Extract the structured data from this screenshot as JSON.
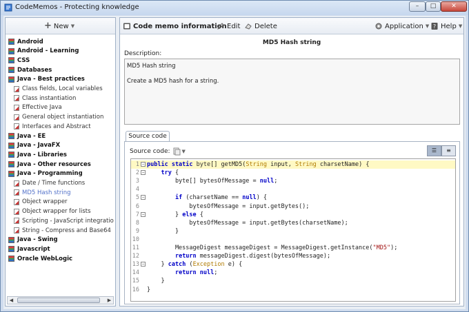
{
  "window": {
    "title": "CodeMemos - Protecting knowledge",
    "min": "–",
    "max": "□",
    "close": "✕"
  },
  "left": {
    "new_label": "New",
    "tree": [
      {
        "label": "Android",
        "type": "cat"
      },
      {
        "label": "Android - Learning",
        "type": "cat"
      },
      {
        "label": "CSS",
        "type": "cat"
      },
      {
        "label": "Databases",
        "type": "cat"
      },
      {
        "label": "Java - Best practices",
        "type": "cat"
      },
      {
        "label": "Class fields, Local variables",
        "type": "sub"
      },
      {
        "label": "Class instantiation",
        "type": "sub"
      },
      {
        "label": "Effective Java",
        "type": "sub"
      },
      {
        "label": "General object instantiation",
        "type": "sub"
      },
      {
        "label": "Interfaces and Abstract",
        "type": "sub"
      },
      {
        "label": "Java - EE",
        "type": "cat"
      },
      {
        "label": "Java - JavaFX",
        "type": "cat"
      },
      {
        "label": "Java - Libraries",
        "type": "cat"
      },
      {
        "label": "Java - Other resources",
        "type": "cat"
      },
      {
        "label": "Java - Programming",
        "type": "cat"
      },
      {
        "label": "Date / Time functions",
        "type": "sub"
      },
      {
        "label": "MD5 Hash string",
        "type": "sub",
        "selected": true
      },
      {
        "label": "Object wrapper",
        "type": "sub"
      },
      {
        "label": "Object wrapper for lists",
        "type": "sub"
      },
      {
        "label": "Scripting - JavaScript integratio",
        "type": "sub"
      },
      {
        "label": "String - Compress and Base64",
        "type": "sub"
      },
      {
        "label": "Java - Swing",
        "type": "cat"
      },
      {
        "label": "Javascript",
        "type": "cat"
      },
      {
        "label": "Oracle WebLogic",
        "type": "cat"
      }
    ]
  },
  "toolbar": {
    "memo_info": "Code memo information",
    "edit": "Edit",
    "delete": "Delete",
    "application": "Application",
    "help": "Help"
  },
  "memo": {
    "header": "MD5 Hash string",
    "description_label": "Description:",
    "description_line1": "MD5 Hash string",
    "description_line2": "Create a MD5 hash for a string.",
    "tab_label": "Source code",
    "source_code_label": "Source code:"
  },
  "code": [
    {
      "n": "1",
      "fold": true,
      "hl": true,
      "segs": [
        [
          "kw",
          "public static "
        ],
        [
          "ty",
          "byte"
        ],
        [
          "tx",
          "[] getMD5("
        ],
        [
          "ex",
          "String"
        ],
        [
          "tx",
          " input, "
        ],
        [
          "ex",
          "String"
        ],
        [
          "tx",
          " charsetName) {"
        ]
      ]
    },
    {
      "n": "2",
      "fold": true,
      "segs": [
        [
          "tx",
          "    "
        ],
        [
          "kw",
          "try"
        ],
        [
          "tx",
          " {"
        ]
      ]
    },
    {
      "n": "3",
      "segs": [
        [
          "tx",
          "        byte[] bytesOfMessage = "
        ],
        [
          "kw",
          "null"
        ],
        [
          "tx",
          ";"
        ]
      ]
    },
    {
      "n": "4",
      "segs": []
    },
    {
      "n": "5",
      "fold": true,
      "segs": [
        [
          "tx",
          "        "
        ],
        [
          "kw",
          "if"
        ],
        [
          "tx",
          " (charsetName == "
        ],
        [
          "kw",
          "null"
        ],
        [
          "tx",
          ") {"
        ]
      ]
    },
    {
      "n": "6",
      "segs": [
        [
          "tx",
          "            bytesOfMessage = input.getBytes();"
        ]
      ]
    },
    {
      "n": "7",
      "fold": true,
      "segs": [
        [
          "tx",
          "        } "
        ],
        [
          "kw",
          "else"
        ],
        [
          "tx",
          " {"
        ]
      ]
    },
    {
      "n": "8",
      "segs": [
        [
          "tx",
          "            bytesOfMessage = input.getBytes(charsetName);"
        ]
      ]
    },
    {
      "n": "9",
      "segs": [
        [
          "tx",
          "        }"
        ]
      ]
    },
    {
      "n": "10",
      "segs": []
    },
    {
      "n": "11",
      "segs": [
        [
          "tx",
          "        MessageDigest messageDigest = MessageDigest.getInstance("
        ],
        [
          "st",
          "\"MD5\""
        ],
        [
          "tx",
          ");"
        ]
      ]
    },
    {
      "n": "12",
      "segs": [
        [
          "tx",
          "        "
        ],
        [
          "kw",
          "return"
        ],
        [
          "tx",
          " messageDigest.digest(bytesOfMessage);"
        ]
      ]
    },
    {
      "n": "13",
      "fold": true,
      "segs": [
        [
          "tx",
          "    } "
        ],
        [
          "kw",
          "catch"
        ],
        [
          "tx",
          " ("
        ],
        [
          "ex",
          "Exception"
        ],
        [
          "tx",
          " e) {"
        ]
      ]
    },
    {
      "n": "14",
      "segs": [
        [
          "tx",
          "        "
        ],
        [
          "kw",
          "return null"
        ],
        [
          "tx",
          ";"
        ]
      ]
    },
    {
      "n": "15",
      "segs": [
        [
          "tx",
          "    }"
        ]
      ]
    },
    {
      "n": "16",
      "segs": [
        [
          "tx",
          "}"
        ]
      ]
    }
  ]
}
